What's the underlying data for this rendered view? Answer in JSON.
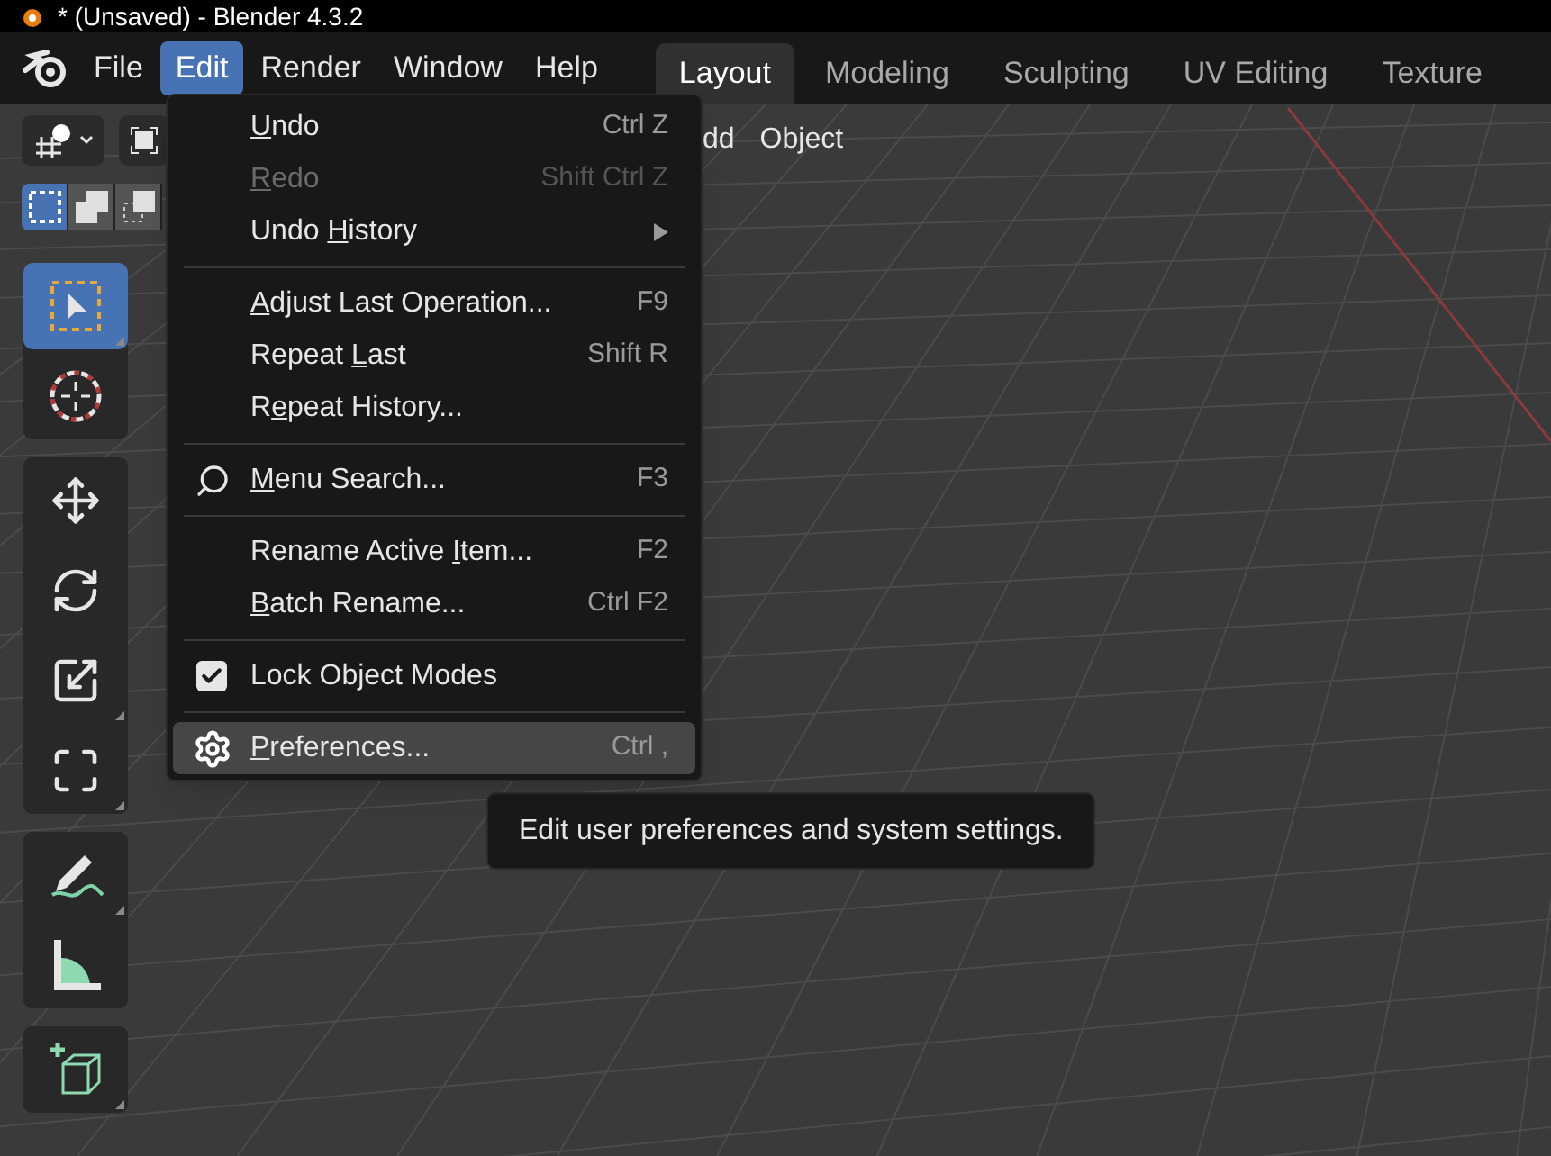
{
  "window": {
    "title": "* (Unsaved) - Blender 4.3.2"
  },
  "menubar": [
    {
      "label": "File",
      "selected": false
    },
    {
      "label": "Edit",
      "selected": true
    },
    {
      "label": "Render",
      "selected": false
    },
    {
      "label": "Window",
      "selected": false
    },
    {
      "label": "Help",
      "selected": false
    }
  ],
  "workspace_tabs": [
    {
      "label": "Layout",
      "selected": true
    },
    {
      "label": "Modeling",
      "selected": false
    },
    {
      "label": "Sculpting",
      "selected": false
    },
    {
      "label": "UV Editing",
      "selected": false
    },
    {
      "label": "Texture",
      "selected": false
    }
  ],
  "viewport_header": {
    "menus": [
      "dd",
      "Object"
    ]
  },
  "select_modes": [
    {
      "kind": "new",
      "selected": true
    },
    {
      "kind": "extend",
      "selected": false
    },
    {
      "kind": "subtract",
      "selected": false
    }
  ],
  "tool_groups": [
    [
      {
        "kind": "select",
        "selected": true
      },
      {
        "kind": "cursor",
        "selected": false
      }
    ],
    [
      {
        "kind": "move",
        "selected": false
      },
      {
        "kind": "rotate",
        "selected": false
      },
      {
        "kind": "scale",
        "selected": false
      },
      {
        "kind": "transform",
        "selected": false
      }
    ],
    [
      {
        "kind": "annotate",
        "selected": false
      },
      {
        "kind": "measure",
        "selected": false
      }
    ],
    [
      {
        "kind": "add-cube",
        "selected": false
      }
    ]
  ],
  "edit_menu": {
    "sections": [
      [
        {
          "kind": "command",
          "label": {
            "key": "U",
            "after": "ndo"
          },
          "shortcut": "Ctrl Z",
          "disabled": false,
          "selected": false
        },
        {
          "kind": "command",
          "label": {
            "key": "R",
            "after": "edo"
          },
          "shortcut": "Shift Ctrl Z",
          "disabled": true,
          "selected": false
        },
        {
          "kind": "submenu",
          "label": {
            "before": "Undo ",
            "key": "H",
            "after": "istory"
          },
          "disabled": false,
          "selected": false
        }
      ],
      [
        {
          "kind": "command",
          "label": {
            "key": "A",
            "after": "djust Last Operation..."
          },
          "shortcut": "F9",
          "disabled": false,
          "selected": false
        },
        {
          "kind": "command",
          "label": {
            "before": "Repeat ",
            "key": "L",
            "after": "ast"
          },
          "shortcut": "Shift R",
          "disabled": false,
          "selected": false
        },
        {
          "kind": "command",
          "label": {
            "before": "R",
            "key": "e",
            "after": "peat History..."
          },
          "disabled": false,
          "selected": false
        }
      ],
      [
        {
          "kind": "search",
          "label": {
            "key": "M",
            "after": "enu Search..."
          },
          "shortcut": "F3",
          "disabled": false,
          "selected": false
        }
      ],
      [
        {
          "kind": "command",
          "label": {
            "before": "Rename Active ",
            "key": "I",
            "after": "tem..."
          },
          "shortcut": "F2",
          "disabled": false,
          "selected": false
        },
        {
          "kind": "command",
          "label": {
            "key": "B",
            "after": "atch Rename..."
          },
          "shortcut": "Ctrl F2",
          "disabled": false,
          "selected": false
        }
      ],
      [
        {
          "kind": "checkbox",
          "label": {
            "before": "Lock Object Modes"
          },
          "checked": true,
          "disabled": false,
          "selected": false
        }
      ],
      [
        {
          "kind": "preferences",
          "label": {
            "key": "P",
            "after": "references..."
          },
          "shortcut": "Ctrl ,",
          "disabled": false,
          "selected": true
        }
      ]
    ]
  },
  "tooltip": {
    "text": "Edit user preferences and system settings."
  }
}
